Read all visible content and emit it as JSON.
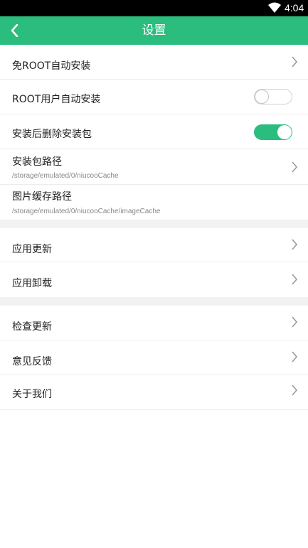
{
  "status_bar": {
    "time": "4:04"
  },
  "header": {
    "title": "设置"
  },
  "section1": [
    {
      "label": "免ROOT自动安装"
    },
    {
      "label": "ROOT用户自动安装",
      "toggle": "off"
    },
    {
      "label": "安装后删除安装包",
      "toggle": "on"
    },
    {
      "label": "安装包路径",
      "sub": "/storage/emulated/0/niucooCache"
    },
    {
      "label": "图片缓存路径",
      "sub": "/storage/emulated/0/niucooCache/imageCache"
    }
  ],
  "section2": [
    {
      "label": "应用更新"
    },
    {
      "label": "应用卸载"
    }
  ],
  "section3": [
    {
      "label": "检查更新"
    },
    {
      "label": "意见反馈"
    },
    {
      "label": "关于我们"
    }
  ],
  "colors": {
    "accent": "#2bbd7e",
    "status_bar": "#000000",
    "divider": "#ececec",
    "section_gap": "#f2f2f2"
  }
}
